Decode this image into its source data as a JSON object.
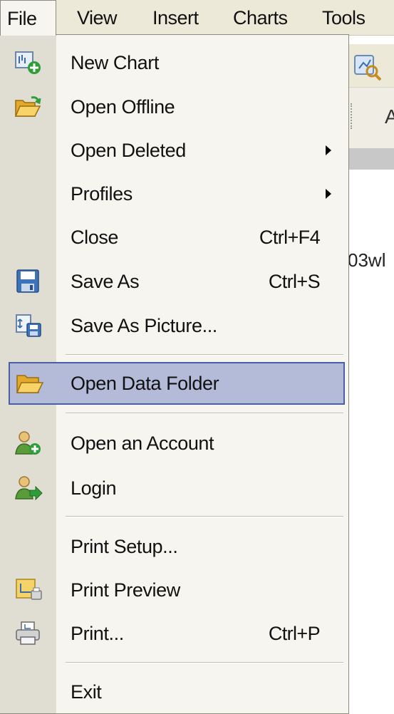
{
  "menubar": {
    "file": "File",
    "view": "View",
    "insert": "Insert",
    "charts": "Charts",
    "tools": "Tools"
  },
  "background": {
    "toolbar_letter": "A",
    "window_text": "03wl"
  },
  "menu": {
    "new_chart": {
      "label": "New Chart",
      "icon": "new-chart-icon"
    },
    "open_offline": {
      "label": "Open Offline",
      "icon": "open-folder-icon"
    },
    "open_deleted": {
      "label": "Open Deleted",
      "has_submenu": true
    },
    "profiles": {
      "label": "Profiles",
      "has_submenu": true
    },
    "close": {
      "label": "Close",
      "shortcut": "Ctrl+F4"
    },
    "save_as": {
      "label": "Save As",
      "shortcut": "Ctrl+S",
      "icon": "floppy-disk-icon"
    },
    "save_as_picture": {
      "label": "Save As Picture...",
      "icon": "save-picture-icon"
    },
    "open_data_folder": {
      "label": "Open Data Folder",
      "icon": "folder-icon",
      "highlighted": true
    },
    "open_account": {
      "label": "Open an Account",
      "icon": "user-add-icon"
    },
    "login": {
      "label": "Login",
      "icon": "user-login-icon"
    },
    "print_setup": {
      "label": "Print Setup..."
    },
    "print_preview": {
      "label": "Print Preview",
      "icon": "print-preview-icon"
    },
    "print": {
      "label": "Print...",
      "shortcut": "Ctrl+P",
      "icon": "printer-icon"
    },
    "exit": {
      "label": "Exit"
    }
  },
  "colors": {
    "menubar_bg": "#ece9d8",
    "menu_bg": "#f6f5ef",
    "gutter_bg": "#e0ded2",
    "highlight_bg": "#b3bbd8",
    "highlight_border": "#4a5fa6"
  }
}
